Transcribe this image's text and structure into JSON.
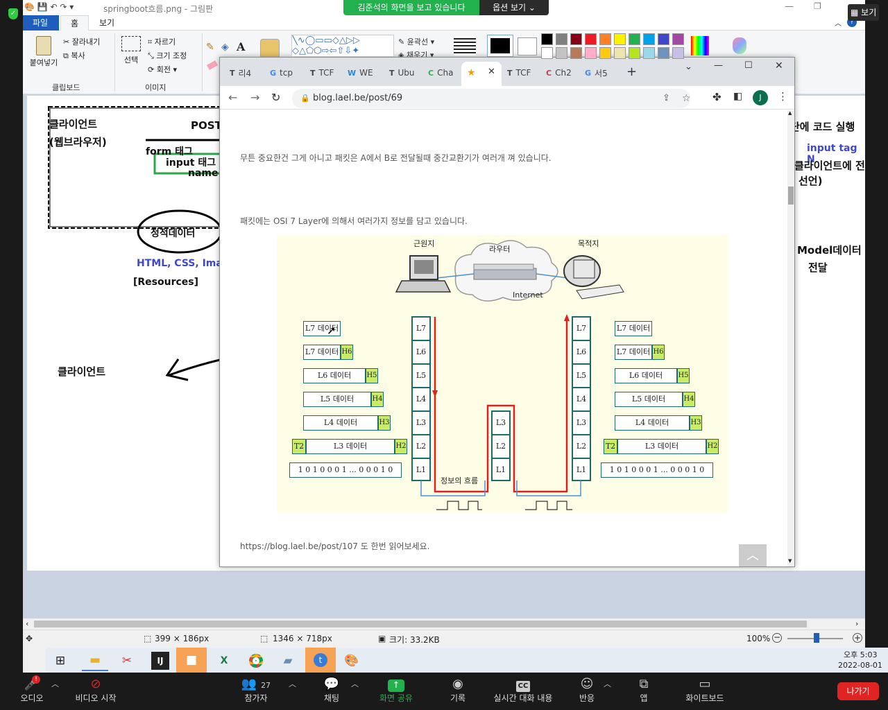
{
  "paint": {
    "title": "springboot흐름.png - 그림판",
    "tabs": [
      "파일",
      "홈",
      "보기"
    ],
    "clipboard": {
      "paste": "붙여넣기",
      "cut": "잘라내기",
      "copy": "복사",
      "group": "클립보드"
    },
    "image": {
      "select": "선택",
      "crop": "자르기",
      "resize": "크기 조정",
      "rotate": "회전",
      "group": "이미지"
    },
    "shapes": {
      "outline": "윤곽선",
      "fill": "채우기"
    },
    "palette": [
      "#000000",
      "#7f7f7f",
      "#880015",
      "#ed1c24",
      "#ff7f27",
      "#fff200",
      "#22b14c",
      "#00a2e8",
      "#3f48cc",
      "#a349a4",
      "#ffffff",
      "#c3c3c3",
      "#b97a57",
      "#ffaec9",
      "#ffc90e",
      "#efe4b0",
      "#b5e61d",
      "#99d9ea",
      "#7092be",
      "#c8bfe7"
    ],
    "canvas": {
      "client_label": "클라이언트",
      "browser_label": "(웹브라우저)",
      "post": "POST",
      "form_tag": "form 태그",
      "input_tag": "input 태그",
      "name": "name",
      "static_data": "정적데이터",
      "static_types": "HTML, CSS, Ima",
      "resources": "[Resources]",
      "client_label2": "클라이언트",
      "right_code": "단에 코드 실행",
      "right_input": "input tag N",
      "right_client": "클라이언트에 전",
      "right_decl": "선언)",
      "right_model": "Model데이터",
      "right_deliver": "전달"
    },
    "status": {
      "selection": "399 × 186px",
      "image_size": "1346 × 718px",
      "file_size": "크기: 33.2KB",
      "zoom": "100%"
    },
    "clock": {
      "time": "오후 5:03",
      "date": "2022-08-01"
    }
  },
  "zoom": {
    "sharing_text": "김준석의 화면을 보고 있습니다",
    "options": "옵션 보기",
    "view": "보기",
    "audio": "오디오",
    "video": "비디오 시작",
    "participants": "참가자",
    "participants_count": "27",
    "chat": "채팅",
    "share": "화면 공유",
    "record": "기록",
    "captions": "실시간 대화 내용",
    "reactions": "반응",
    "apps": "앱",
    "whiteboard": "화이트보드",
    "leave": "나가기"
  },
  "chrome": {
    "tabs": [
      {
        "icon": "T",
        "label": "리4"
      },
      {
        "icon": "G",
        "label": "tcp"
      },
      {
        "icon": "T",
        "label": "TCF"
      },
      {
        "icon": "W",
        "label": "WE"
      },
      {
        "icon": "T",
        "label": "Ubu"
      },
      {
        "icon": "C",
        "label": "Cha"
      },
      {
        "icon": "★",
        "label": ""
      },
      {
        "icon": "T",
        "label": "TCF"
      },
      {
        "icon": "C",
        "label": "Ch2"
      },
      {
        "icon": "G",
        "label": "서5"
      }
    ],
    "url": "blog.lael.be/post/69",
    "profile": "J",
    "para1": "무튼 중요한건 그게 아니고 패킷은 A에서 B로 전달될때 중간교환기가 여러개 껴 있습니다.",
    "para2": "패킷에는 OSI 7 Layer에 의해서 여러가지 정보를 담고 있습니다.",
    "para3_link": "https://blog.lael.be/post/107",
    "para3_rest": " 도 한번 읽어보세요."
  },
  "diagram": {
    "source": "근원지",
    "router": "라우터",
    "dest": "목적지",
    "internet": "Internet",
    "flow": "정보의 흐름",
    "layers": [
      "L7",
      "L6",
      "L5",
      "L4",
      "L3",
      "L2",
      "L1"
    ],
    "mid_layers": [
      "L3",
      "L2",
      "L1"
    ],
    "stack": [
      {
        "data": "L7 데이터",
        "hdr": ""
      },
      {
        "data": "L7 데이터",
        "hdr": "H6"
      },
      {
        "data": "L6 데이터",
        "hdr": "H5"
      },
      {
        "data": "L5 데이터",
        "hdr": "H4"
      },
      {
        "data": "L4 데이터",
        "hdr": "H3"
      },
      {
        "data": "L3 데이터",
        "hdr": "H2",
        "trailer": "T2"
      }
    ],
    "bits": "1 0 1 0 0 0 1 ... 0 0 0 1 0"
  }
}
